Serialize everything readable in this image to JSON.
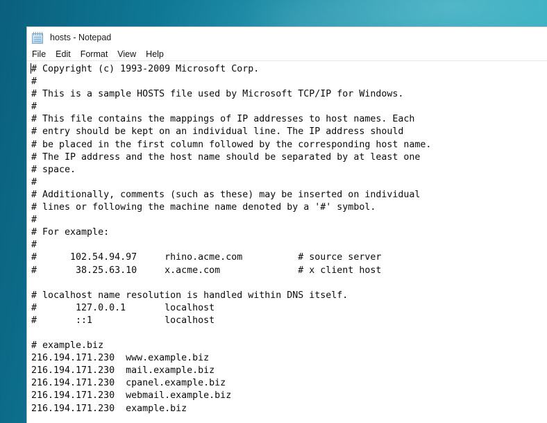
{
  "desktop": {
    "wallpaper_color_left": "#0a5f7d",
    "wallpaper_color_right": "#2fb0c2"
  },
  "window": {
    "title": "hosts - Notepad",
    "icon": "notepad-icon"
  },
  "menu": {
    "items": [
      {
        "label": "File"
      },
      {
        "label": "Edit"
      },
      {
        "label": "Format"
      },
      {
        "label": "View"
      },
      {
        "label": "Help"
      }
    ]
  },
  "editor": {
    "caret_visible": true,
    "text": "# Copyright (c) 1993-2009 Microsoft Corp.\n#\n# This is a sample HOSTS file used by Microsoft TCP/IP for Windows.\n#\n# This file contains the mappings of IP addresses to host names. Each\n# entry should be kept on an individual line. The IP address should\n# be placed in the first column followed by the corresponding host name.\n# The IP address and the host name should be separated by at least one\n# space.\n#\n# Additionally, comments (such as these) may be inserted on individual\n# lines or following the machine name denoted by a '#' symbol.\n#\n# For example:\n#\n#      102.54.94.97     rhino.acme.com          # source server\n#       38.25.63.10     x.acme.com              # x client host\n\n# localhost name resolution is handled within DNS itself.\n#       127.0.0.1       localhost\n#       ::1             localhost\n\n# example.biz\n216.194.171.230  www.example.biz\n216.194.171.230  mail.example.biz\n216.194.171.230  cpanel.example.biz\n216.194.171.230  webmail.example.biz\n216.194.171.230  example.biz",
    "lines": [
      "# Copyright (c) 1993-2009 Microsoft Corp.",
      "#",
      "# This is a sample HOSTS file used by Microsoft TCP/IP for Windows.",
      "#",
      "# This file contains the mappings of IP addresses to host names. Each",
      "# entry should be kept on an individual line. The IP address should",
      "# be placed in the first column followed by the corresponding host name.",
      "# The IP address and the host name should be separated by at least one",
      "# space.",
      "#",
      "# Additionally, comments (such as these) may be inserted on individual",
      "# lines or following the machine name denoted by a '#' symbol.",
      "#",
      "# For example:",
      "#",
      "#      102.54.94.97     rhino.acme.com          # source server",
      "#       38.25.63.10     x.acme.com              # x client host",
      "",
      "# localhost name resolution is handled within DNS itself.",
      "#       127.0.0.1       localhost",
      "#       ::1             localhost",
      "",
      "# example.biz",
      "216.194.171.230  www.example.biz",
      "216.194.171.230  mail.example.biz",
      "216.194.171.230  cpanel.example.biz",
      "216.194.171.230  webmail.example.biz",
      "216.194.171.230  example.biz"
    ],
    "host_entries": [
      {
        "ip": "216.194.171.230",
        "hostname": "www.example.biz"
      },
      {
        "ip": "216.194.171.230",
        "hostname": "mail.example.biz"
      },
      {
        "ip": "216.194.171.230",
        "hostname": "cpanel.example.biz"
      },
      {
        "ip": "216.194.171.230",
        "hostname": "webmail.example.biz"
      },
      {
        "ip": "216.194.171.230",
        "hostname": "example.biz"
      }
    ]
  }
}
